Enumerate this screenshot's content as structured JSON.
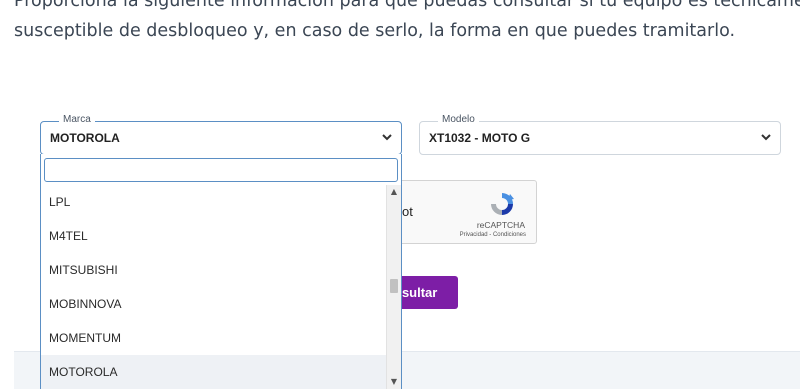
{
  "intro": {
    "line1": "Proporciona la siguiente información para que puedas consultar si tu equipo es técnicamente",
    "line2": "susceptible de desbloqueo y, en caso de serlo, la forma en que puedes tramitarlo."
  },
  "form": {
    "marca": {
      "label": "Marca",
      "value": "MOTOROLA"
    },
    "modelo": {
      "label": "Modelo",
      "value": "XT1032 - MOTO G"
    },
    "captcha": {
      "partial_text": "ot",
      "brand": "reCAPTCHA",
      "links": "Privacidad - Condiciones"
    },
    "submit_partial_label": "nsultar"
  },
  "dropdown": {
    "search_value": "",
    "options": [
      "LPL",
      "M4TEL",
      "MITSUBISHI",
      "MOBINNOVA",
      "MOMENTUM",
      "MOTOROLA"
    ],
    "selected": "MOTOROLA"
  },
  "colors": {
    "accent_button": "#7d1ea6",
    "focus_border": "#5b8fc4"
  }
}
